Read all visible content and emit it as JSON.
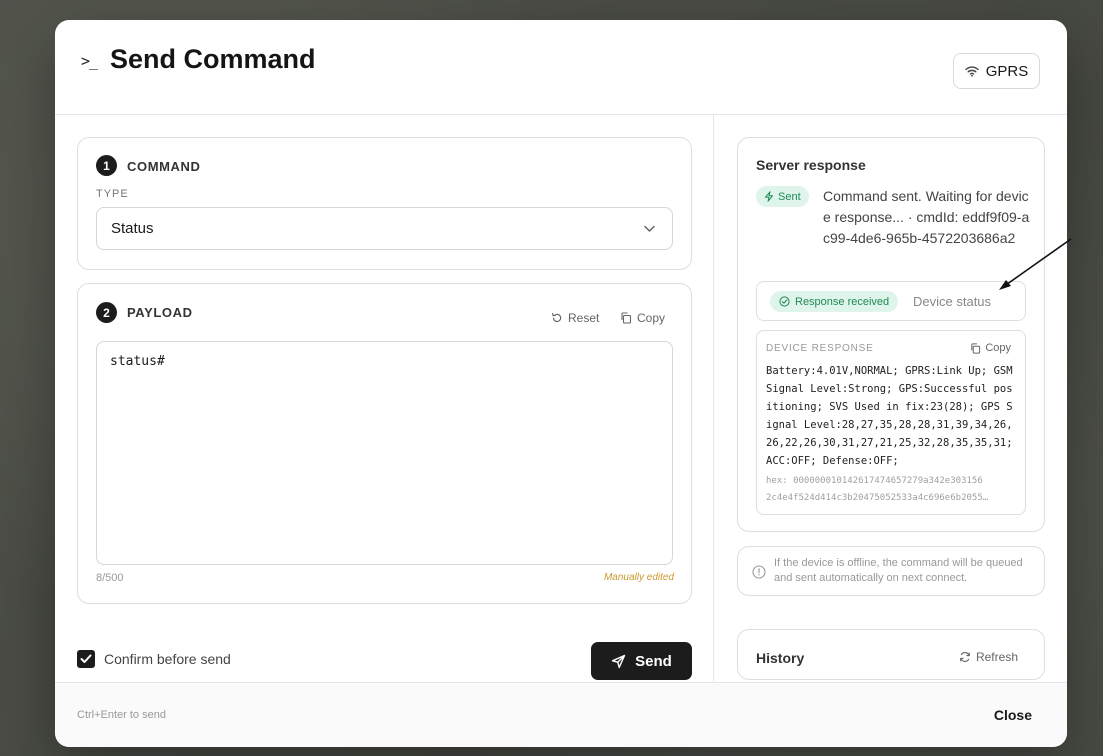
{
  "header": {
    "title": "Send Command",
    "title_icon": ">_",
    "connection_label": "GPRS"
  },
  "command": {
    "step": "1",
    "section_title": "COMMAND",
    "type_label": "TYPE",
    "type_value": "Status"
  },
  "payload": {
    "step": "2",
    "section_title": "PAYLOAD",
    "reset_label": "Reset",
    "copy_label": "Copy",
    "value": "status#",
    "counter": "8/500",
    "edited_note": "Manually edited"
  },
  "actions": {
    "confirm_label": "Confirm before send",
    "confirm_checked": true,
    "send_label": "Send"
  },
  "server_response": {
    "title": "Server response",
    "sent_badge": "Sent",
    "sent_message": "Command sent. Waiting for device response... · cmdId: eddf9f09-ac99-4de6-965b-4572203686a2",
    "received_badge": "Response received",
    "received_label": "Device status",
    "device_response_label": "DEVICE RESPONSE",
    "device_response_copy": "Copy",
    "device_response_text": "Battery:4.01V,NORMAL; GPRS:Link Up; GSM Signal Level:Strong; GPS:Successful positioning; SVS Used in fix:23(28); GPS Signal Level:28,27,35,28,28,31,39,34,26,26,22,26,30,31,27,21,25,32,28,35,35,31; ACC:OFF; Defense:OFF;",
    "hex_line1": "hex: 000000010142617474657279a342e303156",
    "hex_line2": "2c4e4f524d414c3b20475052533a4c696e6b2055…"
  },
  "info": {
    "text": "If the device is offline, the command will be queued and sent automatically on next connect."
  },
  "history": {
    "title": "History",
    "refresh_label": "Refresh"
  },
  "footer": {
    "hint": "Ctrl+Enter to send",
    "close_label": "Close"
  },
  "colors": {
    "accent": "#1c1c1c",
    "success_bg": "#dff4ea",
    "success_fg": "#1f8a55",
    "edited_note": "#c99a2e"
  }
}
